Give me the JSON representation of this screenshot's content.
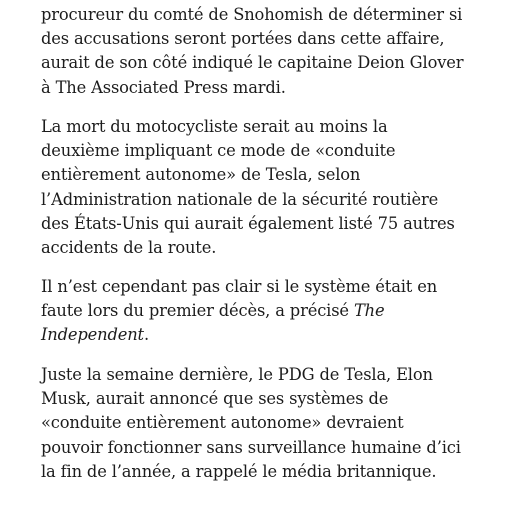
{
  "article": {
    "paragraph_1": {
      "lines": [
        "procureur du comté de Snohomish de déterminer si",
        "des accusations seront portées dans cette affaire,",
        "aurait de son côté indiqué le capitaine Deion Glover",
        "à The Associated Press mardi."
      ]
    },
    "paragraph_2": {
      "lines": [
        "La mort du motocycliste serait au moins la",
        "deuxième impliquant ce mode de «conduite",
        "entièrement autonome» de Tesla, selon",
        "l’Administration nationale de la sécurité routière",
        "des États-Unis qui aurait également listé 75 autres",
        "accidents de la route."
      ]
    },
    "paragraph_3": {
      "line_1": "Il n’est cependant pas clair si le système était en",
      "line_2_text": "faute lors du premier décès, a précisé ",
      "line_2_italic": "The",
      "line_3_italic": "Independent",
      "line_3_text": "."
    },
    "paragraph_4": {
      "lines": [
        "Juste la semaine dernière, le PDG de Tesla, Elon",
        "Musk, aurait annoncé que ses systèmes de",
        "«conduite entièrement autonome» devraient",
        "pouvoir fonctionner sans surveillance humaine d’ici",
        "la fin de l’année, a rappelé le média britannique."
      ]
    }
  }
}
